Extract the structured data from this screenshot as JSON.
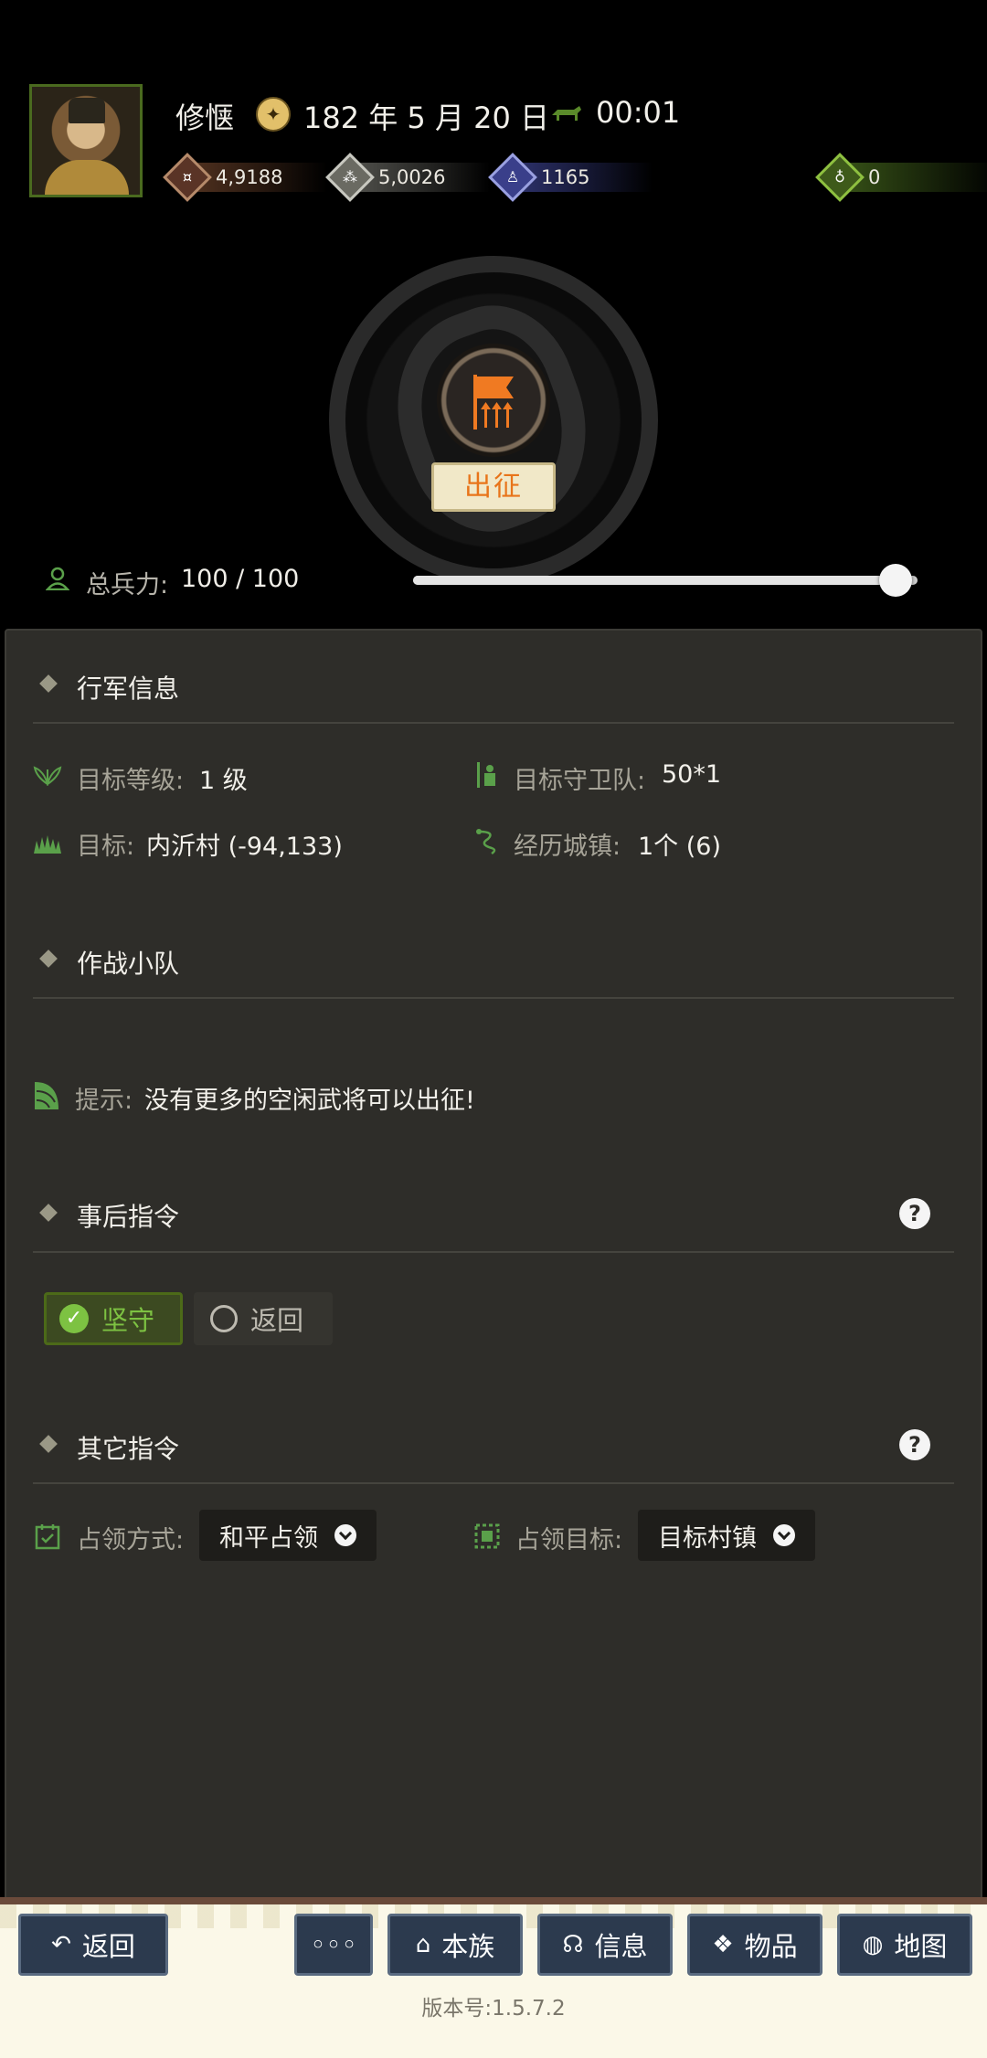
{
  "header": {
    "player_name": "修惬",
    "date": "182 年 5 月 20 日",
    "time": "00:01",
    "resources": [
      {
        "name": "coins-icon",
        "value": "4,9188"
      },
      {
        "name": "grain-icon",
        "value": "5,0026"
      },
      {
        "name": "soldier-icon",
        "value": "1165"
      },
      {
        "name": "bag-icon",
        "value": "0"
      }
    ]
  },
  "march": {
    "button_label": "出征",
    "troops_label": "总兵力:",
    "troops_value": "100 / 100",
    "troops_fraction": 1.0
  },
  "sections": {
    "march_info": {
      "title": "行军信息",
      "target_level_label": "目标等级:",
      "target_level_value": "1 级",
      "target_guard_label": "目标守卫队:",
      "target_guard_value": "50*1",
      "target_label": "目标:",
      "target_value": "内沂村 (-94,133)",
      "towns_label": "经历城镇:",
      "towns_value": "1个 (6)"
    },
    "squad": {
      "title": "作战小队",
      "hint_label": "提示:",
      "hint_text": "没有更多的空闲武将可以出征!"
    },
    "after_order": {
      "title": "事后指令",
      "help": "?",
      "option_hold": "坚守",
      "option_return": "返回",
      "selected": "坚守"
    },
    "other_order": {
      "title": "其它指令",
      "help": "?",
      "occupy_method_label": "占领方式:",
      "occupy_method_value": "和平占领",
      "occupy_target_label": "占领目标:",
      "occupy_target_value": "目标村镇"
    }
  },
  "bottom_nav": {
    "back": "返回",
    "more": "◦◦◦",
    "clan": "本族",
    "info": "信息",
    "items": "物品",
    "map": "地图",
    "version": "版本号:1.5.7.2"
  },
  "colors": {
    "accent_green": "#7dc242",
    "march_orange": "#e8741a",
    "panel_bg": "#2e2d29",
    "nav_button": "#2c3a4e"
  }
}
